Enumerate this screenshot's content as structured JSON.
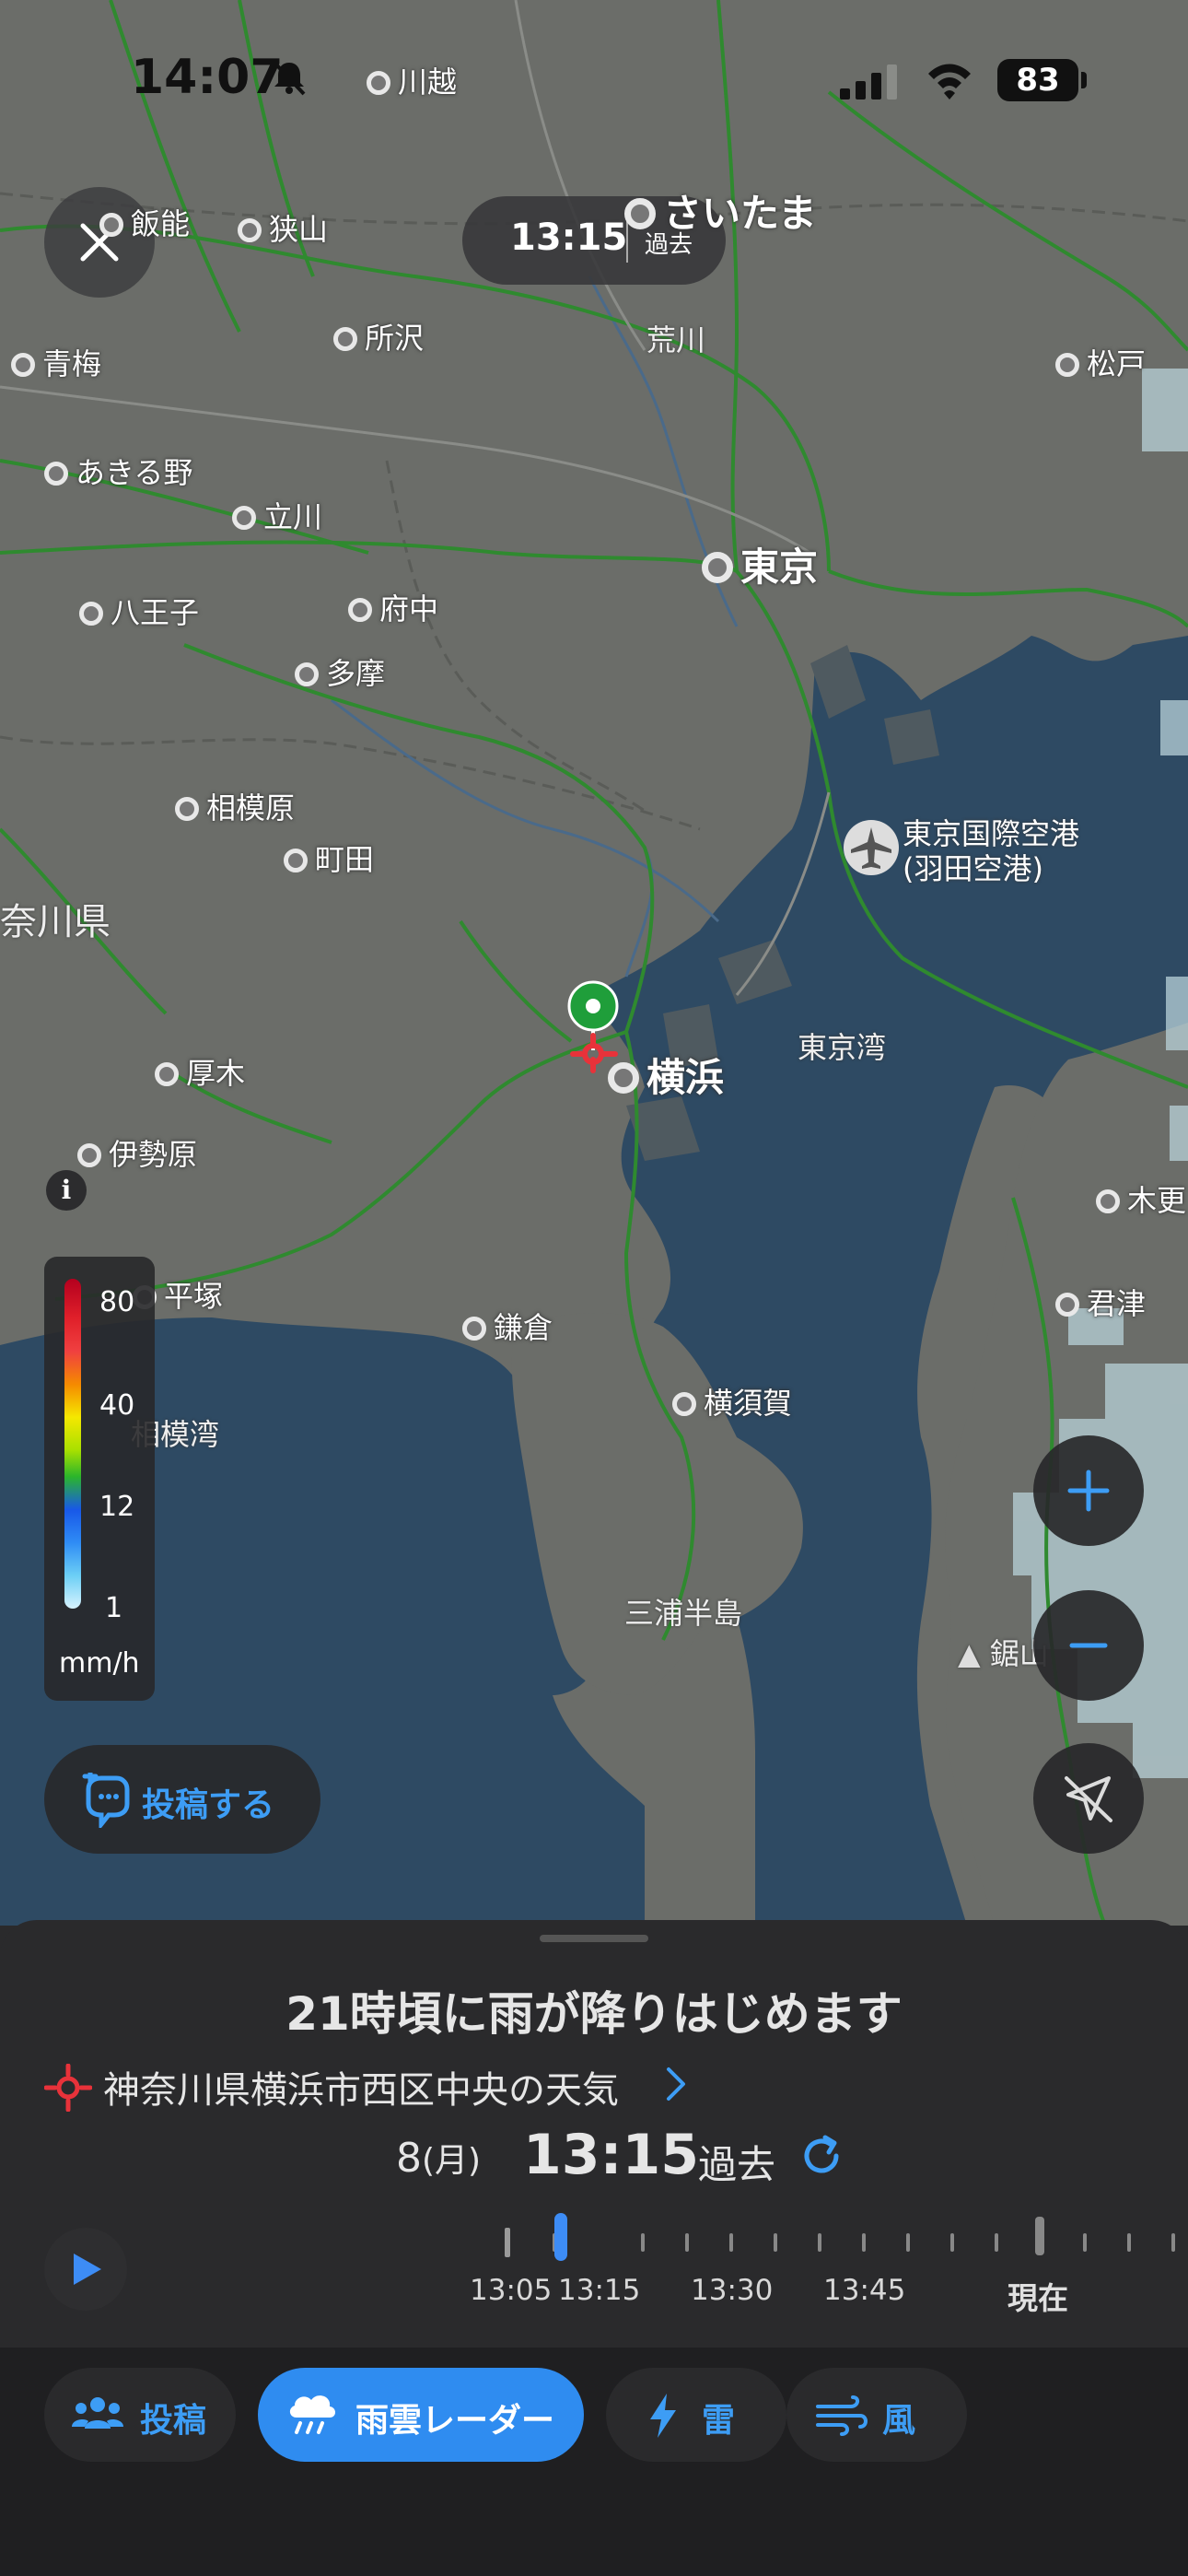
{
  "status_bar": {
    "time": "14:07",
    "battery": "83",
    "icons": [
      "bell-muted-icon",
      "cellular-signal-icon",
      "wifi-icon",
      "battery-icon"
    ]
  },
  "map": {
    "time_pill": {
      "time": "13:15",
      "label": "過去"
    },
    "cities": [
      {
        "name": "川越",
        "size": "normal"
      },
      {
        "name": "飯能",
        "size": "normal"
      },
      {
        "name": "狭山",
        "size": "normal"
      },
      {
        "name": "さいたま",
        "size": "big"
      },
      {
        "name": "所沢",
        "size": "normal"
      },
      {
        "name": "青梅",
        "size": "normal"
      },
      {
        "name": "松戸",
        "size": "normal"
      },
      {
        "name": "あきる野",
        "size": "normal"
      },
      {
        "name": "立川",
        "size": "normal"
      },
      {
        "name": "東京",
        "size": "big"
      },
      {
        "name": "八王子",
        "size": "normal"
      },
      {
        "name": "府中",
        "size": "normal"
      },
      {
        "name": "多摩",
        "size": "normal"
      },
      {
        "name": "相模原",
        "size": "normal"
      },
      {
        "name": "町田",
        "size": "normal"
      },
      {
        "name": "横浜",
        "size": "big"
      },
      {
        "name": "厚木",
        "size": "normal"
      },
      {
        "name": "伊勢原",
        "size": "normal"
      },
      {
        "name": "木更",
        "size": "normal"
      },
      {
        "name": "平塚",
        "size": "normal"
      },
      {
        "name": "鎌倉",
        "size": "normal"
      },
      {
        "name": "君津",
        "size": "normal"
      },
      {
        "name": "横須賀",
        "size": "normal"
      }
    ],
    "areas": [
      "荒川",
      "奈川県",
      "東京湾",
      "相模湾",
      "三浦半島",
      "鋸山"
    ],
    "airport": {
      "line1": "東京国際空港",
      "line2": "(羽田空港)"
    },
    "legend": {
      "values": [
        "80",
        "40",
        "12",
        "1"
      ],
      "unit": "mm/h"
    },
    "post_button": "投稿する",
    "info_icon": "i",
    "colors": {
      "water": "#2e4a63",
      "land": "#6b6d69",
      "rail": "#2f8a2f",
      "accent": "#3d9df5",
      "rain": "#b8d2d8"
    }
  },
  "sheet": {
    "headline": "21時頃に雨が降りはじめます",
    "location": "神奈川県横浜市西区中央の天気",
    "date_day": "8",
    "date_weekday": "(月)",
    "time": "13:15",
    "time_status": "過去",
    "timeline": {
      "labels": [
        "13:05",
        "13:15",
        "13:30",
        "13:45"
      ],
      "now_label": "現在",
      "current_position": 0.1
    }
  },
  "tabs": [
    {
      "label": "投稿",
      "icon": "people-icon",
      "active": false
    },
    {
      "label": "雨雲レーダー",
      "icon": "rain-cloud-icon",
      "active": true
    },
    {
      "label": "雷",
      "icon": "lightning-icon",
      "active": false
    },
    {
      "label": "風",
      "icon": "wind-icon",
      "active": false
    }
  ]
}
